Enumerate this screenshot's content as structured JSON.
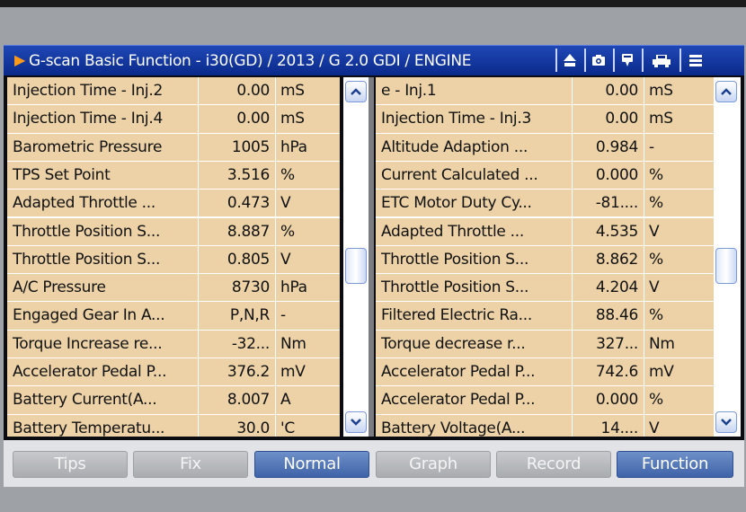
{
  "window": {
    "title": "G-scan Basic Function - i30(GD) / 2013 / G 2.0 GDI / ENGINE",
    "title_icons": [
      "home-icon",
      "camera-icon",
      "comment-icon",
      "vehicle-icon",
      "menu-icon"
    ]
  },
  "left_table": {
    "rows": [
      {
        "name": "Injection Time - Inj.2",
        "value": "0.00",
        "unit": "mS"
      },
      {
        "name": "Injection Time - Inj.4",
        "value": "0.00",
        "unit": "mS"
      },
      {
        "name": "Barometric Pressure",
        "value": "1005",
        "unit": "hPa"
      },
      {
        "name": "TPS Set Point",
        "value": "3.516",
        "unit": "%"
      },
      {
        "name": "Adapted Throttle ...",
        "value": "0.473",
        "unit": "V"
      },
      {
        "name": "Throttle Position S...",
        "value": "8.887",
        "unit": "%"
      },
      {
        "name": "Throttle Position S...",
        "value": "0.805",
        "unit": "V"
      },
      {
        "name": "A/C Pressure",
        "value": "8730",
        "unit": "hPa"
      },
      {
        "name": "Engaged Gear In A...",
        "value": "P,N,R",
        "unit": "-"
      },
      {
        "name": "Torque Increase re...",
        "value": "-32...",
        "unit": "Nm"
      },
      {
        "name": "Accelerator Pedal P...",
        "value": "376.2",
        "unit": "mV"
      },
      {
        "name": "Battery Current(A...",
        "value": "8.007",
        "unit": "A"
      },
      {
        "name": "Battery Temperatu...",
        "value": "30.0",
        "unit": "'C"
      }
    ]
  },
  "right_table": {
    "rows": [
      {
        "name": "e - Inj.1",
        "value": "0.00",
        "unit": "mS"
      },
      {
        "name": "Injection Time - Inj.3",
        "value": "0.00",
        "unit": "mS"
      },
      {
        "name": "Altitude Adaption ...",
        "value": "0.984",
        "unit": "-"
      },
      {
        "name": "Current Calculated ...",
        "value": "0.000",
        "unit": "%"
      },
      {
        "name": "ETC Motor Duty Cy...",
        "value": "-81....",
        "unit": "%"
      },
      {
        "name": "Adapted Throttle ...",
        "value": "4.535",
        "unit": "V"
      },
      {
        "name": "Throttle Position S...",
        "value": "8.862",
        "unit": "%"
      },
      {
        "name": "Throttle Position S...",
        "value": "4.204",
        "unit": "V"
      },
      {
        "name": "Filtered Electric Ra...",
        "value": "88.46",
        "unit": "%"
      },
      {
        "name": "Torque decrease r...",
        "value": "327...",
        "unit": "Nm"
      },
      {
        "name": "Accelerator Pedal P...",
        "value": "742.6",
        "unit": "mV"
      },
      {
        "name": "Accelerator Pedal P...",
        "value": "0.000",
        "unit": "%"
      },
      {
        "name": "Battery Voltage(A...",
        "value": "14....",
        "unit": "V"
      }
    ]
  },
  "scrollbar_icons": {
    "up": "chevron-up-icon",
    "down": "chevron-down-icon"
  },
  "bottom_buttons": [
    {
      "label": "Tips",
      "active": false
    },
    {
      "label": "Fix",
      "active": false
    },
    {
      "label": "Normal",
      "active": true
    },
    {
      "label": "Graph",
      "active": false
    },
    {
      "label": "Record",
      "active": false
    },
    {
      "label": "Function",
      "active": true
    }
  ],
  "colors": {
    "title_bar": "#0a2a8a",
    "row_background": "#ecd2a6",
    "active_button": "#3e63a8",
    "inactive_button": "#a9acb0",
    "title_arrow": "#ff9a1a"
  }
}
